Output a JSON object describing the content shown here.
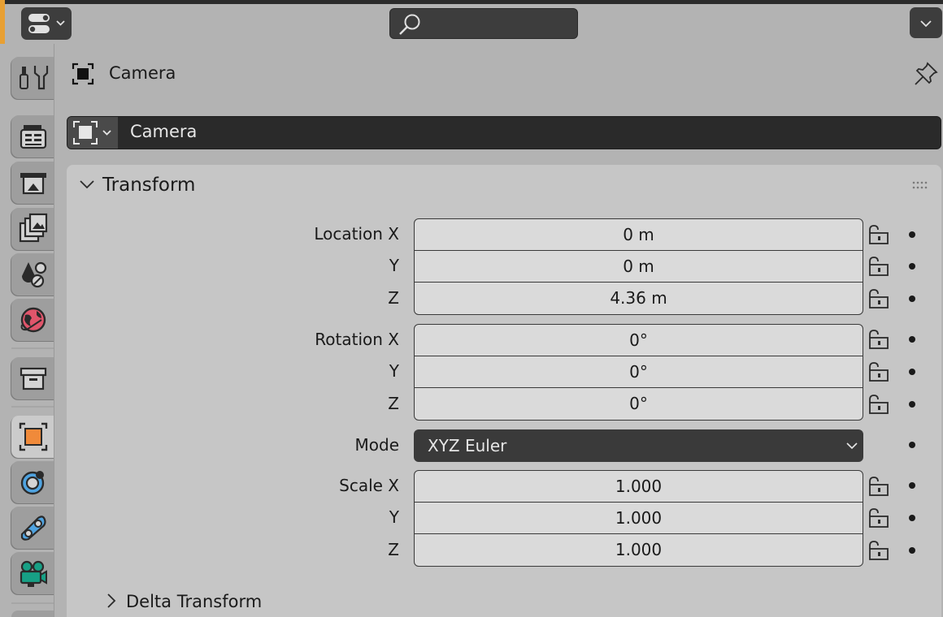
{
  "header": {
    "editor_type_icon": "editor-type-icon",
    "search_icon": "search-icon",
    "options_icon": "chevron-down-icon"
  },
  "tabs": [
    {
      "name": "tool",
      "icon": "tool-icon"
    },
    {
      "name": "render",
      "icon": "render-icon"
    },
    {
      "name": "output",
      "icon": "output-icon"
    },
    {
      "name": "view-layer",
      "icon": "view-layer-icon"
    },
    {
      "name": "scene",
      "icon": "scene-icon"
    },
    {
      "name": "world",
      "icon": "world-icon"
    },
    {
      "name": "collection",
      "icon": "collection-icon"
    },
    {
      "name": "object",
      "icon": "object-icon",
      "active": true
    },
    {
      "name": "physics",
      "icon": "physics-icon"
    },
    {
      "name": "constraints",
      "icon": "constraints-icon"
    },
    {
      "name": "camera-data",
      "icon": "camera-data-icon"
    }
  ],
  "context": {
    "title": "Camera"
  },
  "object_name": "Camera",
  "panel": {
    "title": "Transform",
    "location": {
      "label_x": "Location X",
      "label_y": "Y",
      "label_z": "Z",
      "x": "0 m",
      "y": "0 m",
      "z": "4.36 m"
    },
    "rotation": {
      "label_x": "Rotation X",
      "label_y": "Y",
      "label_z": "Z",
      "x": "0°",
      "y": "0°",
      "z": "0°"
    },
    "mode": {
      "label": "Mode",
      "value": "XYZ Euler"
    },
    "scale": {
      "label_x": "Scale X",
      "label_y": "Y",
      "label_z": "Z",
      "x": "1.000",
      "y": "1.000",
      "z": "1.000"
    }
  },
  "subpanel": {
    "title": "Delta Transform"
  },
  "colors": {
    "accent": "#e8a033",
    "object_tab": "#f08a3a",
    "data_tab": "#17a085"
  }
}
